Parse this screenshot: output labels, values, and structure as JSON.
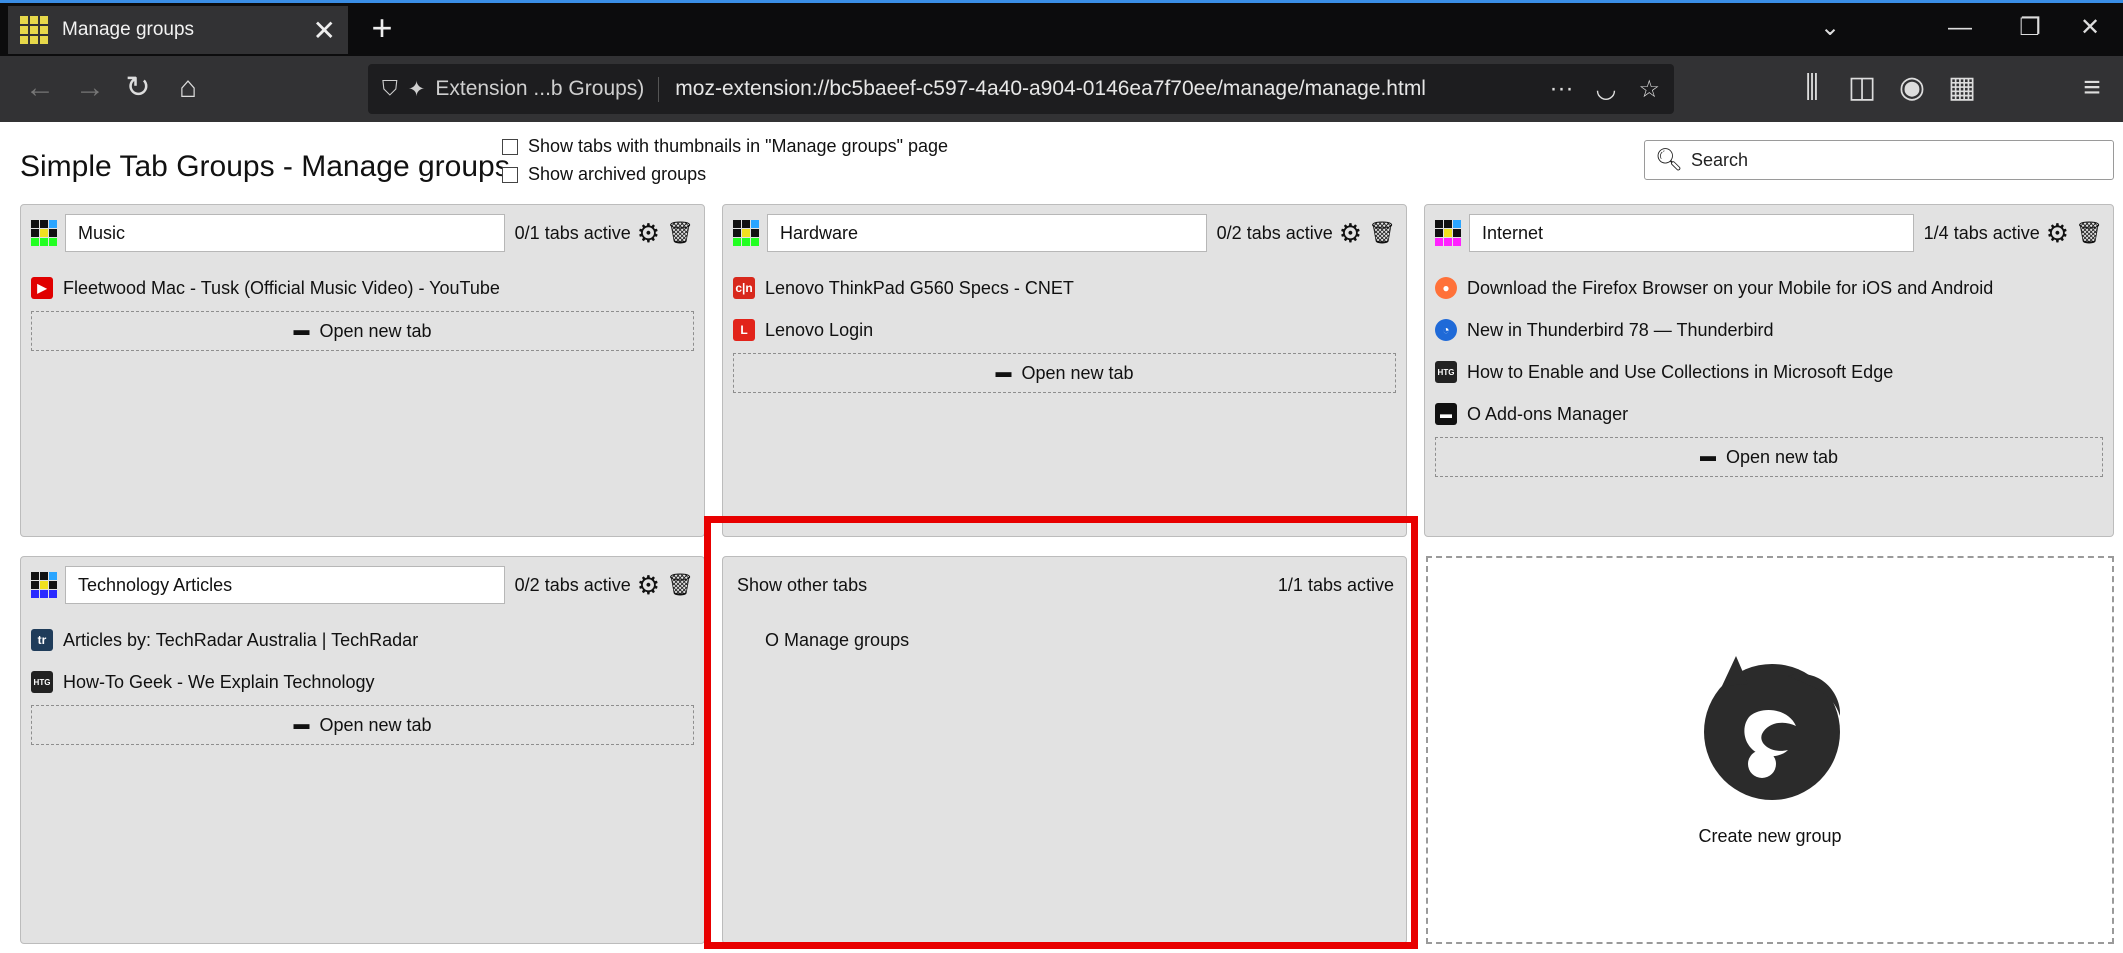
{
  "browser": {
    "tab_title": "Manage groups",
    "tab_close": "✕",
    "new_tab": "+",
    "url_identity": "Extension ...b Groups)",
    "url": "moz-extension://bc5baeef-c597-4a40-a904-0146ea7f70ee/manage/manage.html",
    "url_more": "···"
  },
  "page": {
    "title": "Simple Tab Groups - Manage groups",
    "option_thumbnails": "Show tabs with thumbnails in \"Manage groups\" page",
    "option_archived": "Show archived groups",
    "search_placeholder": "Search"
  },
  "open_new_tab_label": "Open new tab",
  "groups": [
    {
      "name": "Music",
      "active": "0/1 tabs active",
      "icon_colors": [
        "#111111",
        "#111111",
        "#2aa5ff",
        "#111111",
        "#f0e020",
        "#111111",
        "#22ff22",
        "#22ff22",
        "#22ff22"
      ],
      "tabs": [
        {
          "title": "Fleetwood Mac - Tusk (Official Music Video) - YouTube",
          "favicon": "youtube-icon",
          "color": "#e00000"
        }
      ]
    },
    {
      "name": "Hardware",
      "active": "0/2 tabs active",
      "icon_colors": [
        "#111111",
        "#111111",
        "#2aa5ff",
        "#111111",
        "#f0e020",
        "#111111",
        "#22ff22",
        "#22ff22",
        "#22ff22"
      ],
      "tabs": [
        {
          "title": "Lenovo ThinkPad G560 Specs - CNET",
          "favicon": "cnet-icon",
          "color": "#d8281c"
        },
        {
          "title": "Lenovo Login",
          "favicon": "lenovo-icon",
          "color": "#e2231a"
        }
      ]
    },
    {
      "name": "Internet",
      "active": "1/4 tabs active",
      "icon_colors": [
        "#111111",
        "#111111",
        "#2aa5ff",
        "#111111",
        "#f0e020",
        "#111111",
        "#ff22ff",
        "#ff22ff",
        "#ff22ff"
      ],
      "tabs": [
        {
          "title": "Download the Firefox Browser on your Mobile for iOS and Android",
          "favicon": "firefox-icon",
          "color": "#ff7139"
        },
        {
          "title": "New in Thunderbird 78 — Thunderbird",
          "favicon": "thunderbird-icon",
          "color": "#1f6ad8"
        },
        {
          "title": "How to Enable and Use Collections in Microsoft Edge",
          "favicon": "htg-icon",
          "color": "#222222"
        },
        {
          "title": "O Add-ons Manager",
          "favicon": "addons-icon",
          "color": "#111111"
        }
      ]
    },
    {
      "name": "Technology Articles",
      "active": "0/2 tabs active",
      "icon_colors": [
        "#111111",
        "#111111",
        "#2aa5ff",
        "#111111",
        "#f0e020",
        "#111111",
        "#2a2aff",
        "#2a2aff",
        "#2a2aff"
      ],
      "tabs": [
        {
          "title": "Articles by: TechRadar Australia | TechRadar",
          "favicon": "techradar-icon",
          "color": "#1f3c5a"
        },
        {
          "title": "How-To Geek - We Explain Technology",
          "favicon": "htg-icon",
          "color": "#222222"
        }
      ]
    }
  ],
  "other_tabs": {
    "title": "Show other tabs",
    "active": "1/1 tabs active",
    "tabs": [
      {
        "title": "O Manage groups",
        "favicon": "grid-icon"
      }
    ]
  },
  "create_group_label": "Create new group"
}
